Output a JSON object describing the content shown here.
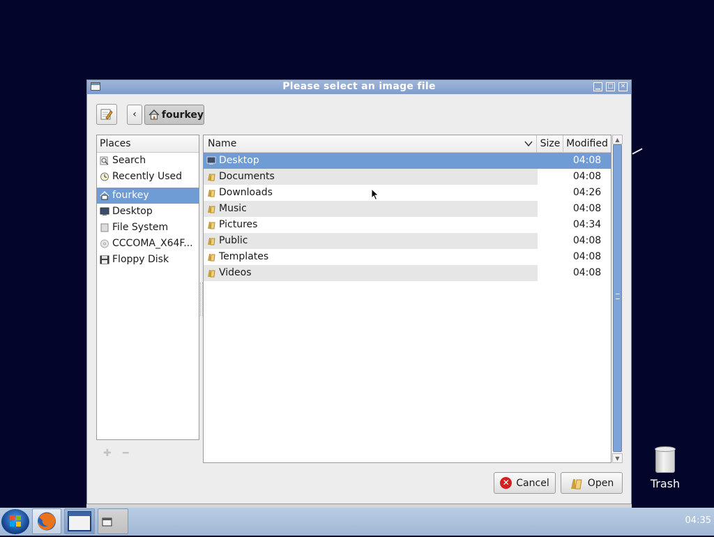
{
  "dialog": {
    "title": "Please select an image file",
    "path_button": "fourkey",
    "places_header": "Places",
    "places": [
      {
        "label": "Search",
        "icon": "search-icon"
      },
      {
        "label": "Recently Used",
        "icon": "clock-icon"
      },
      {
        "label": "fourkey",
        "icon": "home-icon",
        "selected": true
      },
      {
        "label": "Desktop",
        "icon": "desktop-icon"
      },
      {
        "label": "File System",
        "icon": "drive-icon"
      },
      {
        "label": "CCCOMA_X64F...",
        "icon": "cdrom-icon"
      },
      {
        "label": "Floppy Disk",
        "icon": "floppy-icon"
      }
    ],
    "columns": {
      "name": "Name",
      "size": "Size",
      "modified": "Modified"
    },
    "files": [
      {
        "name": "Desktop",
        "modified": "04:08",
        "selected": true
      },
      {
        "name": "Documents",
        "modified": "04:08"
      },
      {
        "name": "Downloads",
        "modified": "04:26"
      },
      {
        "name": "Music",
        "modified": "04:08"
      },
      {
        "name": "Pictures",
        "modified": "04:34"
      },
      {
        "name": "Public",
        "modified": "04:08"
      },
      {
        "name": "Templates",
        "modified": "04:08"
      },
      {
        "name": "Videos",
        "modified": "04:08"
      }
    ],
    "cancel_label": "Cancel",
    "open_label": "Open"
  },
  "desktop": {
    "trash_label": "Trash"
  },
  "taskbar": {
    "clock": "04:35"
  },
  "colors": {
    "selection": "#6f9cd5",
    "titlebar": "#8aa6d1",
    "desktop_bg": "#03062a"
  }
}
